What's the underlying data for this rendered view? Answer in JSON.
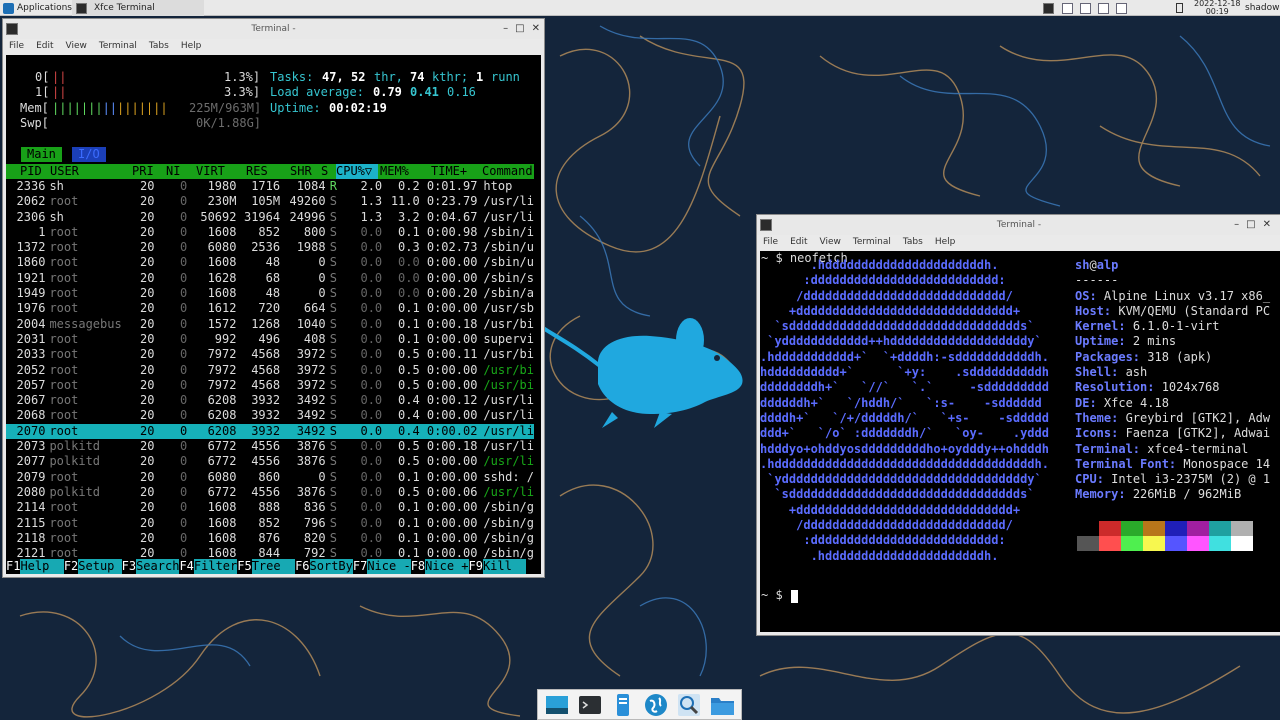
{
  "topbar": {
    "applications": "Applications",
    "task_xfce": "Xfce Terminal",
    "date": "2022-12-18",
    "time": "00:19",
    "user": "shadow"
  },
  "htop_window": {
    "title": "Terminal -",
    "menu": [
      "File",
      "Edit",
      "View",
      "Terminal",
      "Tabs",
      "Help"
    ],
    "meters": {
      "cpu0_label": "0[",
      "cpu0_pct": "1.3%]",
      "cpu1_label": "1[",
      "cpu1_pct": "3.3%]",
      "mem_label": "Mem[",
      "mem_val": "225M/963M]",
      "swp_label": "Swp[",
      "swp_val": "0K/1.88G]",
      "tasks_label": "Tasks:",
      "tasks_val": "47,",
      "thr_val": "52",
      "thr_label": "thr,",
      "kthr_val": "74",
      "kthr_label": "kthr;",
      "run_val": "1",
      "run_label": "runn",
      "load_label": "Load average:",
      "load1": "0.79",
      "load5": "0.41",
      "load15": "0.16",
      "uptime_label": "Uptime:",
      "uptime_val": "00:02:19"
    },
    "tabs": [
      "Main",
      "I/O"
    ],
    "columns": [
      "PID",
      "USER",
      "PRI",
      "NI",
      "VIRT",
      "RES",
      "SHR",
      "S",
      "CPU%▽",
      "MEM%",
      "TIME+",
      "Command"
    ],
    "rows": [
      [
        "2336",
        "sh",
        "20",
        "0",
        "1980",
        "1716",
        "1084",
        "R",
        "2.0",
        "0.2",
        "0:01.97",
        "htop"
      ],
      [
        "2062",
        "root",
        "20",
        "0",
        "230M",
        "105M",
        "49260",
        "S",
        "1.3",
        "11.0",
        "0:23.79",
        "/usr/li"
      ],
      [
        "2306",
        "sh",
        "20",
        "0",
        "50692",
        "31964",
        "24996",
        "S",
        "1.3",
        "3.2",
        "0:04.67",
        "/usr/li"
      ],
      [
        "1",
        "root",
        "20",
        "0",
        "1608",
        "852",
        "800",
        "S",
        "0.0",
        "0.1",
        "0:00.98",
        "/sbin/i"
      ],
      [
        "1372",
        "root",
        "20",
        "0",
        "6080",
        "2536",
        "1988",
        "S",
        "0.0",
        "0.3",
        "0:02.73",
        "/sbin/u"
      ],
      [
        "1860",
        "root",
        "20",
        "0",
        "1608",
        "48",
        "0",
        "S",
        "0.0",
        "0.0",
        "0:00.00",
        "/sbin/u"
      ],
      [
        "1921",
        "root",
        "20",
        "0",
        "1628",
        "68",
        "0",
        "S",
        "0.0",
        "0.0",
        "0:00.00",
        "/sbin/s"
      ],
      [
        "1949",
        "root",
        "20",
        "0",
        "1608",
        "48",
        "0",
        "S",
        "0.0",
        "0.0",
        "0:00.20",
        "/sbin/a"
      ],
      [
        "1976",
        "root",
        "20",
        "0",
        "1612",
        "720",
        "664",
        "S",
        "0.0",
        "0.1",
        "0:00.00",
        "/usr/sb"
      ],
      [
        "2004",
        "messagebus",
        "20",
        "0",
        "1572",
        "1268",
        "1040",
        "S",
        "0.0",
        "0.1",
        "0:00.18",
        "/usr/bi"
      ],
      [
        "2031",
        "root",
        "20",
        "0",
        "992",
        "496",
        "408",
        "S",
        "0.0",
        "0.1",
        "0:00.00",
        "supervi"
      ],
      [
        "2033",
        "root",
        "20",
        "0",
        "7972",
        "4568",
        "3972",
        "S",
        "0.0",
        "0.5",
        "0:00.11",
        "/usr/bi"
      ],
      [
        "2052",
        "root",
        "20",
        "0",
        "7972",
        "4568",
        "3972",
        "S",
        "0.0",
        "0.5",
        "0:00.00",
        "/usr/bi"
      ],
      [
        "2057",
        "root",
        "20",
        "0",
        "7972",
        "4568",
        "3972",
        "S",
        "0.0",
        "0.5",
        "0:00.00",
        "/usr/bi"
      ],
      [
        "2067",
        "root",
        "20",
        "0",
        "6208",
        "3932",
        "3492",
        "S",
        "0.0",
        "0.4",
        "0:00.12",
        "/usr/li"
      ],
      [
        "2068",
        "root",
        "20",
        "0",
        "6208",
        "3932",
        "3492",
        "S",
        "0.0",
        "0.4",
        "0:00.00",
        "/usr/li"
      ],
      [
        "2070",
        "root",
        "20",
        "0",
        "6208",
        "3932",
        "3492",
        "S",
        "0.0",
        "0.4",
        "0:00.02",
        "/usr/li"
      ],
      [
        "2073",
        "polkitd",
        "20",
        "0",
        "6772",
        "4556",
        "3876",
        "S",
        "0.0",
        "0.5",
        "0:00.18",
        "/usr/li"
      ],
      [
        "2077",
        "polkitd",
        "20",
        "0",
        "6772",
        "4556",
        "3876",
        "S",
        "0.0",
        "0.5",
        "0:00.00",
        "/usr/li"
      ],
      [
        "2079",
        "root",
        "20",
        "0",
        "6080",
        "860",
        "0",
        "S",
        "0.0",
        "0.1",
        "0:00.00",
        "sshd: /"
      ],
      [
        "2080",
        "polkitd",
        "20",
        "0",
        "6772",
        "4556",
        "3876",
        "S",
        "0.0",
        "0.5",
        "0:00.06",
        "/usr/li"
      ],
      [
        "2114",
        "root",
        "20",
        "0",
        "1608",
        "888",
        "836",
        "S",
        "0.0",
        "0.1",
        "0:00.00",
        "/sbin/g"
      ],
      [
        "2115",
        "root",
        "20",
        "0",
        "1608",
        "852",
        "796",
        "S",
        "0.0",
        "0.1",
        "0:00.00",
        "/sbin/g"
      ],
      [
        "2118",
        "root",
        "20",
        "0",
        "1608",
        "876",
        "820",
        "S",
        "0.0",
        "0.1",
        "0:00.00",
        "/sbin/g"
      ],
      [
        "2121",
        "root",
        "20",
        "0",
        "1608",
        "844",
        "792",
        "S",
        "0.0",
        "0.1",
        "0:00.00",
        "/sbin/g"
      ]
    ],
    "selected_row": 16,
    "fkeys": [
      {
        "key": "F1",
        "label": "Help  "
      },
      {
        "key": "F2",
        "label": "Setup "
      },
      {
        "key": "F3",
        "label": "Search"
      },
      {
        "key": "F4",
        "label": "Filter"
      },
      {
        "key": "F5",
        "label": "Tree  "
      },
      {
        "key": "F6",
        "label": "SortBy"
      },
      {
        "key": "F7",
        "label": "Nice -"
      },
      {
        "key": "F8",
        "label": "Nice +"
      },
      {
        "key": "F9",
        "label": "Kill  "
      }
    ]
  },
  "neofetch_window": {
    "title": "Terminal -",
    "menu": [
      "File",
      "Edit",
      "View",
      "Terminal",
      "Tabs",
      "Help"
    ],
    "command_line": "~ $ neofetch",
    "logo": [
      "       .hddddddddddddddddddddddh.",
      "      :dddddddddddddddddddddddddd:",
      "     /dddddddddddddddddddddddddddd/",
      "    +dddddddddddddddddddddddddddddd+",
      "  `sdddddddddddddddddddddddddddddddds`",
      " `ydddddddddddd++hdddddddddddddddddddy`",
      ".hddddddddddd+`  `+ddddh:-sdddddddddddh.",
      "hdddddddddd+`      `+y:    .sddddddddddh",
      "ddddddddh+`   `//`   `.`     -sddddddddd",
      "ddddddh+`   `/hddh/`   `:s-    -sdddddd",
      "ddddh+`   `/+/dddddh/`   `+s-    -sddddd",
      "ddd+`   `/o` :dddddddh/`   `oy-    .yddd",
      "hdddyo+ohddyosdddddddddho+oydddy++ohdddh",
      ".hddddddddddddddddddddddddddddddddddddh.",
      " `yddddddddddddddddddddddddddddddddddy`",
      "  `sdddddddddddddddddddddddddddddddds`",
      "    +dddddddddddddddddddddddddddddd+",
      "     /dddddddddddddddddddddddddddd/",
      "      :dddddddddddddddddddddddddd:",
      "       .hddddddddddddddddddddddh."
    ],
    "user": "sh",
    "at": "@",
    "host": "alp",
    "separator": "------",
    "info": [
      {
        "key": "OS",
        "value": "Alpine Linux v3.17 x86_"
      },
      {
        "key": "Host",
        "value": "KVM/QEMU (Standard PC"
      },
      {
        "key": "Kernel",
        "value": "6.1.0-1-virt"
      },
      {
        "key": "Uptime",
        "value": "2 mins"
      },
      {
        "key": "Packages",
        "value": "318 (apk)"
      },
      {
        "key": "Shell",
        "value": "ash"
      },
      {
        "key": "Resolution",
        "value": "1024x768"
      },
      {
        "key": "DE",
        "value": "Xfce 4.18"
      },
      {
        "key": "Theme",
        "value": "Greybird [GTK2], Adw"
      },
      {
        "key": "Icons",
        "value": "Faenza [GTK2], Adwai"
      },
      {
        "key": "Terminal",
        "value": "xfce4-terminal"
      },
      {
        "key": "Terminal Font",
        "value": "Monospace 14"
      },
      {
        "key": "CPU",
        "value": "Intel i3-2375M (2) @ 1"
      },
      {
        "key": "Memory",
        "value": "226MiB / 962MiB"
      }
    ],
    "palette_top": [
      "#000000",
      "#cc2a2a",
      "#2aaa2a",
      "#b8761a",
      "#1f1fb8",
      "#a01fa0",
      "#1fa0a0",
      "#b0b0b0"
    ],
    "palette_bottom": [
      "#555555",
      "#ff4f4f",
      "#4fef4f",
      "#f7f74f",
      "#5555ff",
      "#ff55ff",
      "#40e0e0",
      "#ffffff"
    ],
    "prompt": "~ $"
  },
  "dock": {
    "items": [
      "show-desktop-icon",
      "terminal-icon",
      "file-manager-icon",
      "web-browser-icon",
      "search-icon",
      "folder-icon"
    ]
  }
}
